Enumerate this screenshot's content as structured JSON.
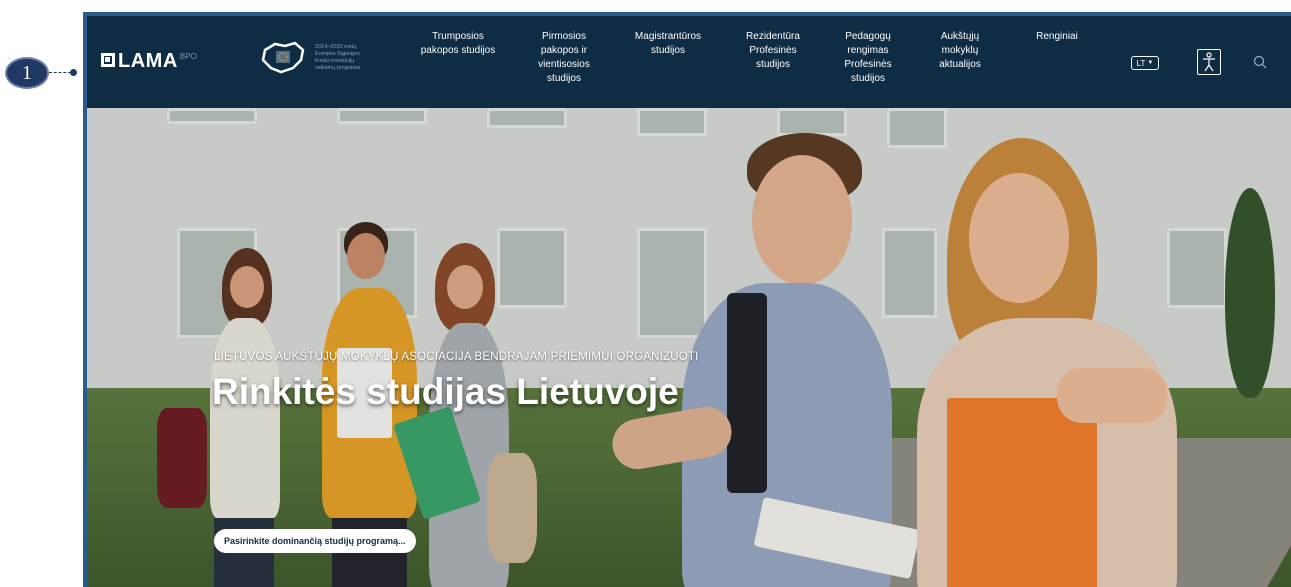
{
  "annotation": {
    "marker_number": "1"
  },
  "header": {
    "logo_text": "LAMA",
    "logo_suffix": "BPO",
    "eu_text": "2014–2020 metų Europos Sąjungos fondų investicijų veiksmų programa",
    "nav_items": [
      "Trumposios pakopos studijos",
      "Pirmosios pakopos ir vientisosios studijos",
      "Magistrantūros studijos",
      "Rezidentūra Profesinės studijos",
      "Pedagogų rengimas Profesinės studijos",
      "Aukštųjų mokyklų aktualijos",
      "Renginiai"
    ],
    "language": "LT",
    "icons": {
      "accessibility": "accessibility-icon",
      "search": "search-icon"
    }
  },
  "hero": {
    "subtitle": "LIETUVOS AUKŠTŲJŲ MOKYKLŲ ASOCIACIJA BENDRAJAM PRIĖMIMUI ORGANIZUOTI",
    "title": "Rinkitės studijas Lietuvoje",
    "cta_label": "Pasirinkite dominančią studijų programą..."
  },
  "colors": {
    "header_bg": "#0e2c44",
    "marker_bg": "#1f3864",
    "frame_border": "#2a5b8f"
  }
}
